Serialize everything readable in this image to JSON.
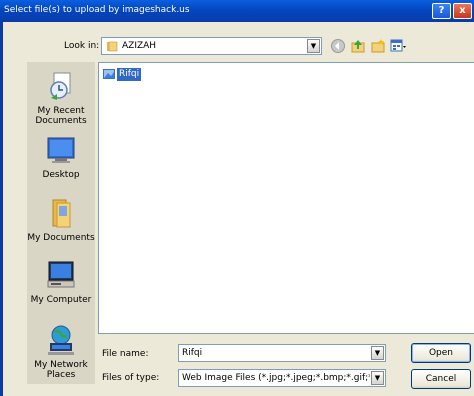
{
  "window": {
    "title": "Select file(s) to upload by imageshack.us",
    "help_label": "?",
    "close_label": "x"
  },
  "lookin": {
    "label": "Look in:",
    "value": "AZIZAH"
  },
  "places": [
    {
      "label": "My Recent Documents",
      "icon": "recent-documents-icon"
    },
    {
      "label": "Desktop",
      "icon": "desktop-icon"
    },
    {
      "label": "My Documents",
      "icon": "my-documents-icon"
    },
    {
      "label": "My Computer",
      "icon": "my-computer-icon"
    },
    {
      "label": "My Network Places",
      "icon": "network-places-icon"
    }
  ],
  "files": [
    {
      "name": "Rifqi",
      "selected": true
    }
  ],
  "form": {
    "filename_label": "File name:",
    "filename_value": "Rifqi",
    "filetype_label": "Files of type:",
    "filetype_value": "Web Image Files (*.jpg;*.jpeg;*.bmp;*.gif;*.png;*",
    "open_label": "Open",
    "cancel_label": "Cancel"
  },
  "colors": {
    "titlebar": "#0a5fe0",
    "selection": "#316ac5",
    "dialog_bg": "#ece9d8"
  }
}
